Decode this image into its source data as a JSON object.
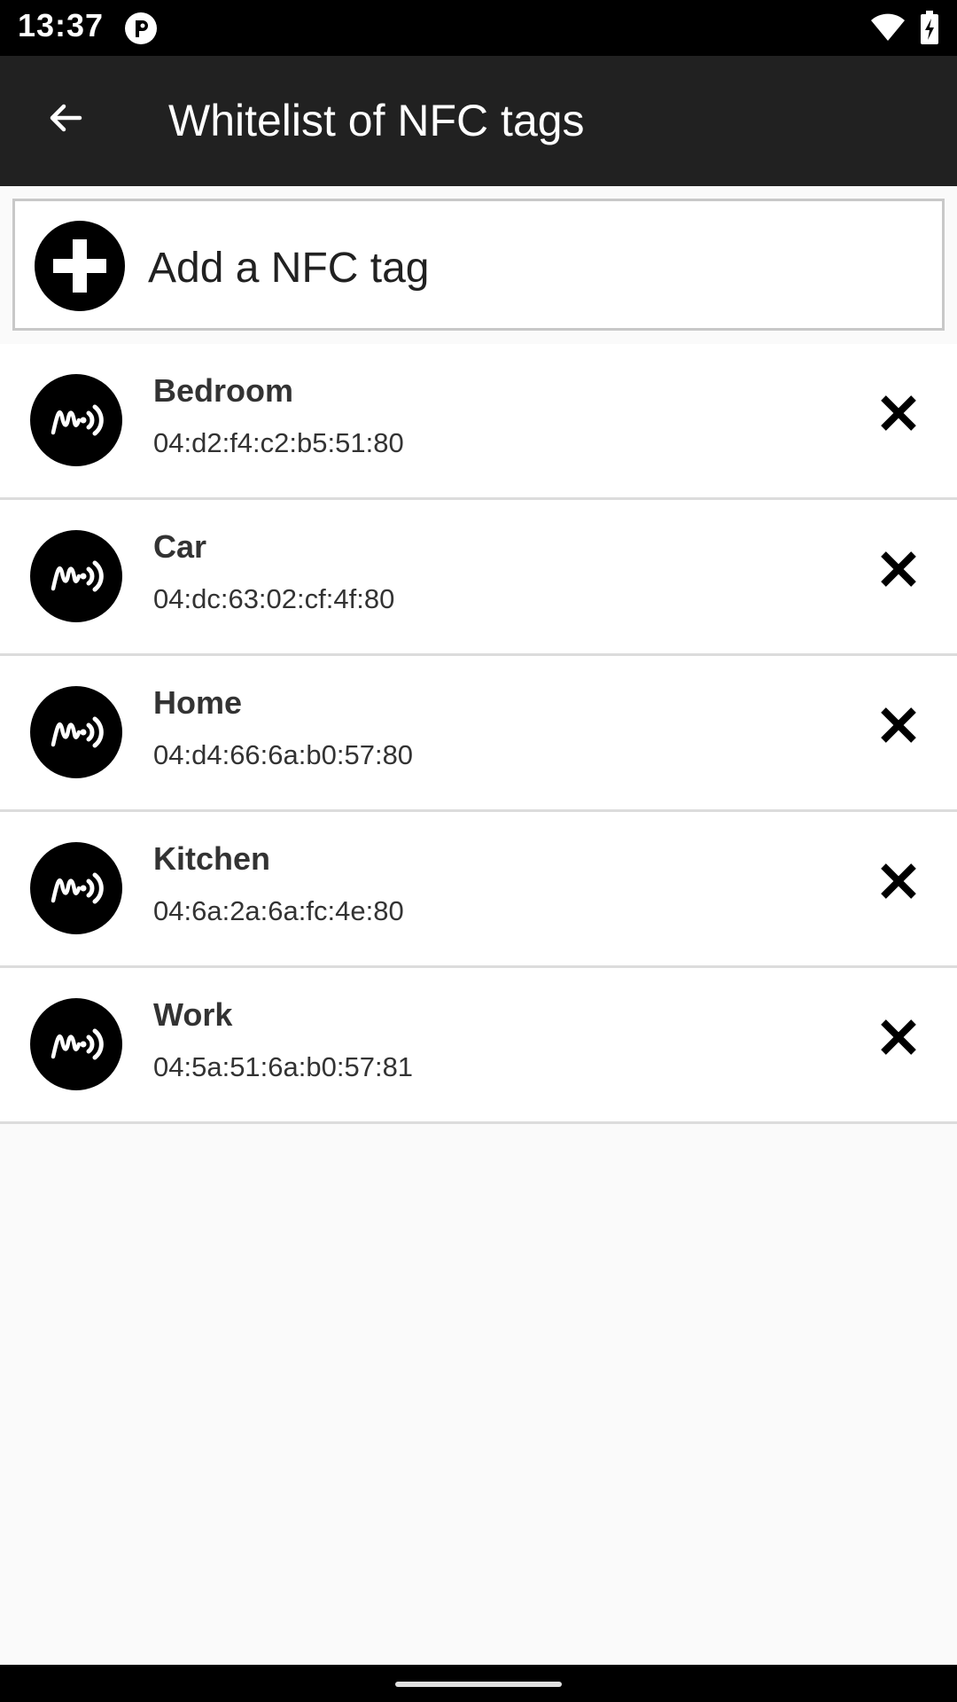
{
  "status_bar": {
    "time": "13:37",
    "icons": [
      "app-notification-icon",
      "wifi-icon",
      "battery-charging-icon"
    ]
  },
  "app_bar": {
    "title": "Whitelist of NFC tags",
    "back_icon": "arrow-left-icon"
  },
  "add_button": {
    "label": "Add a NFC tag",
    "icon": "plus-circle-icon"
  },
  "tags": [
    {
      "name": "Bedroom",
      "id": "04:d2:f4:c2:b5:51:80"
    },
    {
      "name": "Car",
      "id": "04:dc:63:02:cf:4f:80"
    },
    {
      "name": "Home",
      "id": "04:d4:66:6a:b0:57:80"
    },
    {
      "name": "Kitchen",
      "id": "04:6a:2a:6a:fc:4e:80"
    },
    {
      "name": "Work",
      "id": "04:5a:51:6a:b0:57:81"
    }
  ],
  "colors": {
    "app_bar": "#212121",
    "status_bar": "#000000",
    "background": "#fafafa",
    "text": "#333333"
  }
}
